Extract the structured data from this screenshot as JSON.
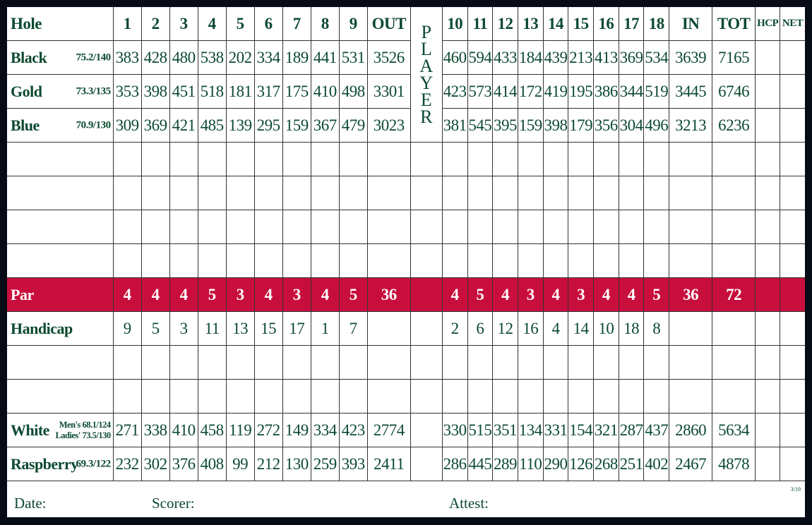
{
  "header": {
    "label": "Hole",
    "front": [
      "1",
      "2",
      "3",
      "4",
      "5",
      "6",
      "7",
      "8",
      "9"
    ],
    "out": "OUT",
    "player": [
      "P",
      "L",
      "A",
      "Y",
      "E",
      "R"
    ],
    "back": [
      "10",
      "11",
      "12",
      "13",
      "14",
      "15",
      "16",
      "17",
      "18"
    ],
    "in": "IN",
    "tot": "TOT",
    "hcp": "HCP",
    "net": "NET"
  },
  "rows": [
    {
      "type": "tee",
      "name": "Black",
      "rating": "75.2/140",
      "front": [
        "383",
        "428",
        "480",
        "538",
        "202",
        "334",
        "189",
        "441",
        "531"
      ],
      "out": "3526",
      "back": [
        "460",
        "594",
        "433",
        "184",
        "439",
        "213",
        "413",
        "369",
        "534"
      ],
      "in": "3639",
      "tot": "7165"
    },
    {
      "type": "tee",
      "name": "Gold",
      "rating": "73.3/135",
      "front": [
        "353",
        "398",
        "451",
        "518",
        "181",
        "317",
        "175",
        "410",
        "498"
      ],
      "out": "3301",
      "back": [
        "423",
        "573",
        "414",
        "172",
        "419",
        "195",
        "386",
        "344",
        "519"
      ],
      "in": "3445",
      "tot": "6746"
    },
    {
      "type": "tee",
      "name": "Blue",
      "rating": "70.9/130",
      "front": [
        "309",
        "369",
        "421",
        "485",
        "139",
        "295",
        "159",
        "367",
        "479"
      ],
      "out": "3023",
      "back": [
        "381",
        "545",
        "395",
        "159",
        "398",
        "179",
        "356",
        "304",
        "496"
      ],
      "in": "3213",
      "tot": "6236"
    },
    {
      "type": "blank"
    },
    {
      "type": "blank"
    },
    {
      "type": "blank"
    },
    {
      "type": "blank"
    },
    {
      "type": "par",
      "name": "Par",
      "front": [
        "4",
        "4",
        "4",
        "5",
        "3",
        "4",
        "3",
        "4",
        "5"
      ],
      "out": "36",
      "back": [
        "4",
        "5",
        "4",
        "3",
        "4",
        "3",
        "4",
        "4",
        "5"
      ],
      "in": "36",
      "tot": "72"
    },
    {
      "type": "tee",
      "name": "Handicap",
      "front": [
        "9",
        "5",
        "3",
        "11",
        "13",
        "15",
        "17",
        "1",
        "7"
      ],
      "out": "",
      "back": [
        "2",
        "6",
        "12",
        "16",
        "4",
        "14",
        "10",
        "18",
        "8"
      ],
      "in": "",
      "tot": ""
    },
    {
      "type": "blank"
    },
    {
      "type": "blank"
    },
    {
      "type": "tee",
      "name": "White",
      "rating_lines": [
        "Men's 68.1/124",
        "Ladies' 73.5/130"
      ],
      "front": [
        "271",
        "338",
        "410",
        "458",
        "119",
        "272",
        "149",
        "334",
        "423"
      ],
      "out": "2774",
      "back": [
        "330",
        "515",
        "351",
        "134",
        "331",
        "154",
        "321",
        "287",
        "437"
      ],
      "in": "2860",
      "tot": "5634"
    },
    {
      "type": "tee",
      "name": "Raspberry",
      "rating": "69.3/122",
      "front": [
        "232",
        "302",
        "376",
        "408",
        "99",
        "212",
        "130",
        "259",
        "393"
      ],
      "out": "2411",
      "back": [
        "286",
        "445",
        "289",
        "110",
        "290",
        "126",
        "268",
        "251",
        "402"
      ],
      "in": "2467",
      "tot": "4878"
    }
  ],
  "footer": {
    "date": "Date:",
    "scorer": "Scorer:",
    "attest": "Attest:",
    "version": "3/19"
  },
  "colors": {
    "text": "#0c4a30",
    "par_row": "#c80e3c",
    "background": "#060b16"
  }
}
